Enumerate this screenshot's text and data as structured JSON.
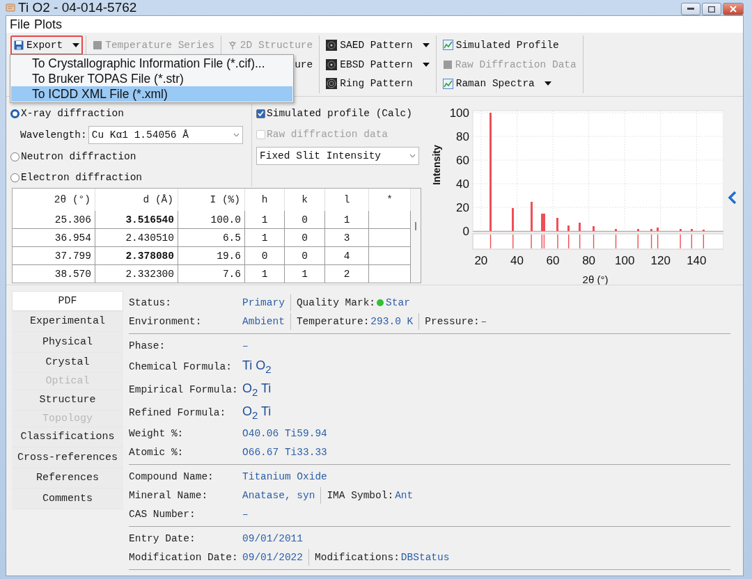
{
  "window": {
    "title": "Ti O2 - 04-014-5762"
  },
  "menu_bar": [
    "File",
    "Plots"
  ],
  "toolbar": {
    "groups": [
      {
        "items": [
          {
            "label": "Export",
            "kind": "save",
            "dropdown": true,
            "disabled": false,
            "highlighted": true
          }
        ]
      },
      {
        "items": [
          {
            "label": "Temperature Series",
            "kind": "block",
            "dropdown": false,
            "disabled": true,
            "highlighted": false
          }
        ]
      },
      {
        "items": [
          {
            "label": "2D Structure",
            "kind": "structure",
            "dropdown": false,
            "disabled": true,
            "highlighted": false
          },
          {
            "label": "ure",
            "kind": "none",
            "dropdown": false,
            "disabled": false,
            "highlighted": false,
            "clipped": true
          }
        ]
      },
      {
        "items": [
          {
            "label": "SAED Pattern",
            "kind": "pattern",
            "dropdown": true,
            "disabled": false,
            "highlighted": false
          },
          {
            "label": "EBSD Pattern",
            "kind": "pattern",
            "dropdown": true,
            "disabled": false,
            "highlighted": false
          },
          {
            "label": "Ring Pattern",
            "kind": "ring",
            "dropdown": false,
            "disabled": false,
            "highlighted": false
          }
        ]
      },
      {
        "items": [
          {
            "label": "Simulated Profile",
            "kind": "profile",
            "dropdown": false,
            "disabled": false,
            "highlighted": false
          },
          {
            "label": "Raw Diffraction Data",
            "kind": "block",
            "dropdown": false,
            "disabled": true,
            "highlighted": false
          },
          {
            "label": "Raman Spectra",
            "kind": "profile",
            "dropdown": true,
            "disabled": false,
            "highlighted": false
          }
        ]
      }
    ]
  },
  "export_menu": [
    {
      "label": "To Crystallographic Information File (*.cif)...",
      "selected": false
    },
    {
      "label": "To Bruker TOPAS File (*.str)",
      "selected": false
    },
    {
      "label": "To ICDD XML File (*.xml)",
      "selected": true
    }
  ],
  "diffraction": {
    "radios": [
      {
        "label": "X-ray diffraction",
        "selected": true
      },
      {
        "label": "Neutron diffraction",
        "selected": false
      },
      {
        "label": "Electron diffraction",
        "selected": false
      }
    ],
    "wavelength": {
      "label": "Wavelength:",
      "value": "Cu Kα1 1.54056 Å"
    }
  },
  "profile_options": {
    "checkboxes": [
      {
        "label": "Simulated profile (Calc)",
        "checked": true,
        "disabled": false
      },
      {
        "label": "Raw diffraction data",
        "checked": false,
        "disabled": true
      }
    ],
    "intensity_select": {
      "value": "Fixed Slit Intensity"
    }
  },
  "peak_table": {
    "columns": [
      "2θ (°)",
      "d (Å)",
      "I (%)",
      "h",
      "k",
      "l",
      "*"
    ],
    "rows": [
      {
        "cells": [
          "25.306",
          "3.516540",
          "100.0",
          "1",
          "0",
          "1",
          ""
        ],
        "emphasized": true
      },
      {
        "cells": [
          "36.954",
          "2.430510",
          "6.5",
          "1",
          "0",
          "3",
          ""
        ],
        "emphasized": false
      },
      {
        "cells": [
          "37.799",
          "2.378080",
          "19.6",
          "0",
          "0",
          "4",
          ""
        ],
        "emphasized": true
      },
      {
        "cells": [
          "38.570",
          "2.332300",
          "7.6",
          "1",
          "1",
          "2",
          ""
        ],
        "emphasized": false
      }
    ]
  },
  "pattern_chart": {
    "chart_data": {
      "type": "bar",
      "xlabel": "2θ (°)",
      "ylabel": "Intensity",
      "grid": true,
      "x": [
        25.3,
        37.8,
        48.0,
        53.9,
        55.1,
        62.7,
        68.8,
        75.0,
        82.7,
        95.1,
        107.4,
        114.9,
        118.4,
        131.0,
        137.3,
        143.9
      ],
      "values": [
        100,
        19.6,
        25,
        15,
        15,
        11,
        5,
        7,
        4,
        2,
        2,
        2,
        3,
        2,
        2,
        1
      ],
      "xlim": [
        15.4,
        155
      ],
      "ylim": [
        0,
        100
      ],
      "xticks": [
        20,
        40,
        60,
        80,
        100,
        120,
        140
      ],
      "yticks": [
        0,
        20,
        40,
        60,
        80,
        100
      ]
    }
  },
  "details_nav": [
    {
      "label": "PDF",
      "selected": true,
      "disabled": false
    },
    {
      "label": "Experimental",
      "selected": false,
      "disabled": false
    },
    {
      "label": "Physical",
      "selected": false,
      "disabled": false
    },
    {
      "label": "Crystal",
      "selected": false,
      "disabled": false
    },
    {
      "label": "Optical",
      "selected": false,
      "disabled": true
    },
    {
      "label": "Structure",
      "selected": false,
      "disabled": false
    },
    {
      "label": "Topology",
      "selected": false,
      "disabled": true
    },
    {
      "label": "Classifications",
      "selected": false,
      "disabled": false
    },
    {
      "label": "Cross-references",
      "selected": false,
      "disabled": false
    },
    {
      "label": "References",
      "selected": false,
      "disabled": false
    },
    {
      "label": "Comments",
      "selected": false,
      "disabled": false
    }
  ],
  "details": [
    {
      "rows": [
        {
          "fields": [
            {
              "label": "Status:",
              "value": "Primary",
              "kind": "text"
            },
            {
              "label": "Quality Mark:",
              "value": "Star",
              "kind": "status",
              "color": "#33c033"
            }
          ]
        },
        {
          "fields": [
            {
              "label": "Environment:",
              "value": "Ambient",
              "kind": "text"
            },
            {
              "label": "Temperature:",
              "value": "293.0 K",
              "kind": "text"
            },
            {
              "label": "Pressure:",
              "value": "–",
              "kind": "text"
            }
          ]
        }
      ]
    },
    {
      "rows": [
        {
          "fields": [
            {
              "label": "Phase:",
              "value": "–",
              "kind": "text"
            }
          ]
        },
        {
          "fields": [
            {
              "label": "Chemical Formula:",
              "value": "Ti O$_{2}$",
              "kind": "formula"
            }
          ]
        },
        {
          "fields": [
            {
              "label": "Empirical Formula:",
              "value": "O$_{2}$ Ti",
              "kind": "formula"
            }
          ]
        },
        {
          "fields": [
            {
              "label": "Refined Formula:",
              "value": "O$_{2}$ Ti",
              "kind": "formula"
            }
          ]
        },
        {
          "fields": [
            {
              "label": "Weight %:",
              "value": "O40.06 Ti59.94",
              "kind": "text"
            }
          ]
        },
        {
          "fields": [
            {
              "label": "Atomic %:",
              "value": "O66.67 Ti33.33",
              "kind": "text"
            }
          ]
        }
      ]
    },
    {
      "rows": [
        {
          "fields": [
            {
              "label": "Compound Name:",
              "value": "Titanium Oxide",
              "kind": "text"
            }
          ]
        },
        {
          "fields": [
            {
              "label": "Mineral Name:",
              "value": "Anatase, syn",
              "kind": "text"
            },
            {
              "label": "IMA Symbol:",
              "value": "Ant",
              "kind": "text"
            }
          ]
        },
        {
          "fields": [
            {
              "label": "CAS Number:",
              "value": "–",
              "kind": "text"
            }
          ]
        }
      ]
    },
    {
      "rows": [
        {
          "fields": [
            {
              "label": "Entry Date:",
              "value": "09/01/2011",
              "kind": "text"
            }
          ]
        },
        {
          "fields": [
            {
              "label": "Modification Date:",
              "value": "09/01/2022",
              "kind": "text"
            },
            {
              "label": "Modifications:",
              "value": "DBStatus",
              "kind": "text"
            }
          ]
        }
      ]
    }
  ]
}
